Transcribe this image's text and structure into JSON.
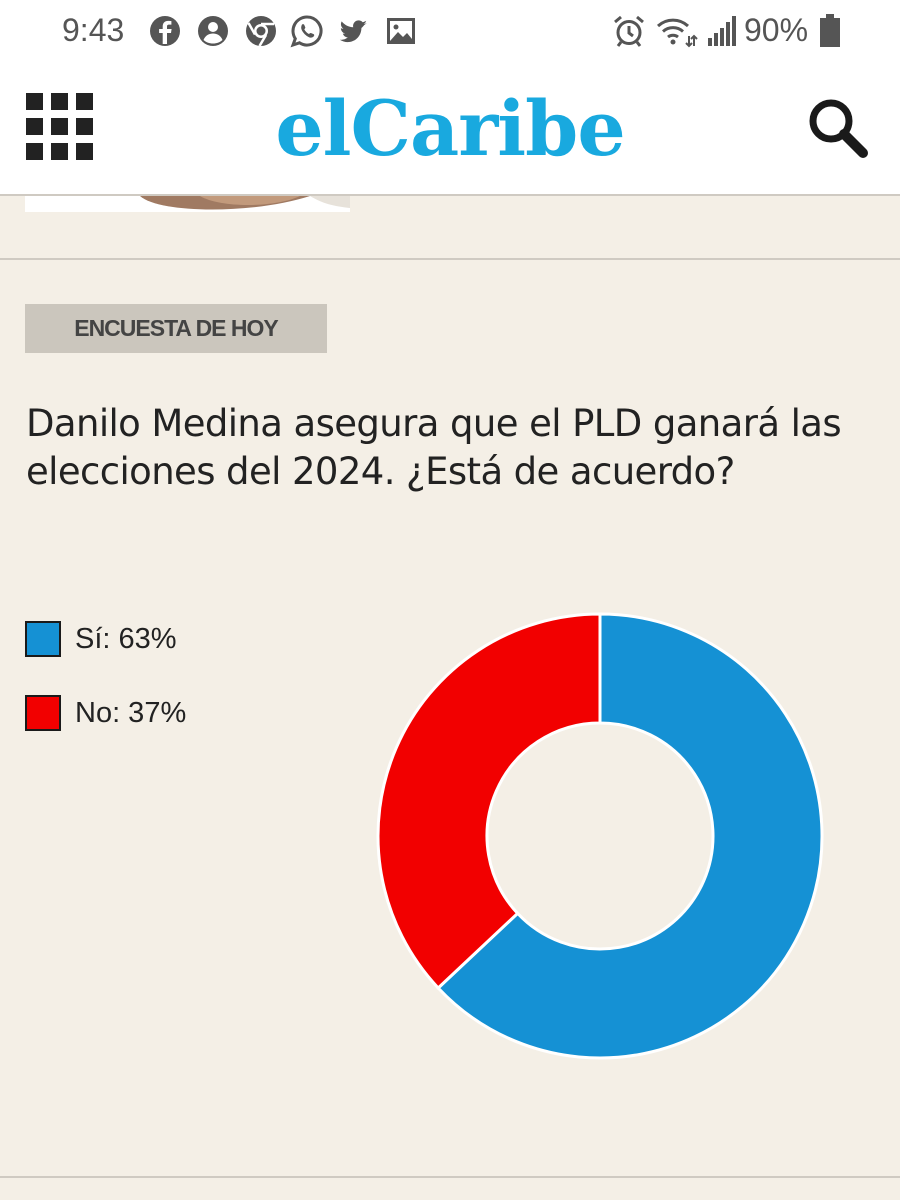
{
  "status_bar": {
    "time": "9:43",
    "left_icons": [
      "facebook-icon",
      "account-icon",
      "chrome-icon",
      "whatsapp-icon",
      "twitter-icon",
      "gallery-icon"
    ],
    "right_icons": [
      "alarm-icon",
      "wifi-icon",
      "signal-icon"
    ],
    "battery": "90%"
  },
  "header": {
    "logo": "elCaribe",
    "logo_color": "#19a9df",
    "menu_icon": "grid-menu-icon",
    "search_icon": "search-icon"
  },
  "poll": {
    "tag": "ENCUESTA DE HOY",
    "question": "Danilo Medina asegura que el PLD ganará las elecciones del 2024. ¿Está de acuerdo?",
    "legend": [
      {
        "label": "Sí: 63%",
        "color": "#1591d4"
      },
      {
        "label": "No: 37%",
        "color": "#f20000"
      }
    ]
  },
  "chart_data": {
    "type": "pie",
    "donut": true,
    "categories": [
      "Sí",
      "No"
    ],
    "values": [
      63,
      37
    ],
    "colors": [
      "#1591d4",
      "#f20000"
    ],
    "legend_position": "left"
  }
}
